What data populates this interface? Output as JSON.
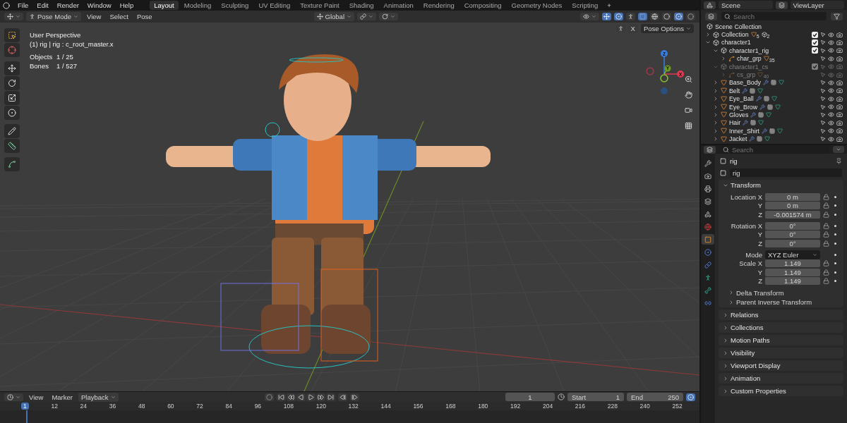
{
  "topbar": {
    "menus": [
      "File",
      "Edit",
      "Render",
      "Window",
      "Help"
    ],
    "workspaces": [
      {
        "label": "Layout",
        "selected": true
      },
      {
        "label": "Modeling",
        "selected": false
      },
      {
        "label": "Sculpting",
        "selected": false
      },
      {
        "label": "UV Editing",
        "selected": false
      },
      {
        "label": "Texture Paint",
        "selected": false
      },
      {
        "label": "Shading",
        "selected": false
      },
      {
        "label": "Animation",
        "selected": false
      },
      {
        "label": "Rendering",
        "selected": false
      },
      {
        "label": "Compositing",
        "selected": false
      },
      {
        "label": "Geometry Nodes",
        "selected": false
      },
      {
        "label": "Scripting",
        "selected": false
      }
    ],
    "add_tab": "+"
  },
  "viewport": {
    "header": {
      "mode": "Pose Mode",
      "menus": [
        "View",
        "Select",
        "Pose"
      ],
      "orientation": "Global"
    },
    "info": {
      "view": "User Perspective",
      "object": "(1) rig | rig : c_root_master.x",
      "stats": [
        {
          "label": "Objects",
          "value": "1 / 25"
        },
        {
          "label": "Bones",
          "value": "1 / 527"
        }
      ]
    },
    "x_mirror": "X",
    "pose_options": "Pose Options",
    "gizmo_axes": [
      "Z",
      "Y",
      "X"
    ]
  },
  "outliner": {
    "scene": "Scene",
    "view_layer": "ViewLayer",
    "search": {
      "placeholder": "Search"
    },
    "root": "Scene Collection",
    "items": [
      {
        "name": "Collection",
        "kind": "collection",
        "expanded": false,
        "disabled": false,
        "checked": true,
        "badges": [
          "5",
          "2"
        ]
      },
      {
        "name": "character1",
        "kind": "collection",
        "expanded": true,
        "disabled": false,
        "checked": true,
        "children": [
          {
            "name": "character1_rig",
            "kind": "collection",
            "expanded": true,
            "disabled": false,
            "checked": true,
            "children": [
              {
                "name": "char_grp",
                "kind": "armature",
                "expanded": false,
                "disabled": false,
                "badges": [
                  "35"
                ]
              }
            ]
          },
          {
            "name": "character1_cs",
            "kind": "collection",
            "expanded": true,
            "disabled": true,
            "checked": true,
            "children": [
              {
                "name": "cs_grp",
                "kind": "armature",
                "expanded": false,
                "disabled": true,
                "badges": [
                  "40"
                ]
              }
            ]
          },
          {
            "name": "Base_Body",
            "kind": "mesh",
            "expanded": false,
            "disabled": false
          },
          {
            "name": "Belt",
            "kind": "mesh",
            "expanded": false,
            "disabled": false
          },
          {
            "name": "Eye_Ball",
            "kind": "mesh",
            "expanded": false,
            "disabled": false
          },
          {
            "name": "Eye_Brow",
            "kind": "mesh",
            "expanded": false,
            "disabled": false
          },
          {
            "name": "Gloves",
            "kind": "mesh",
            "expanded": false,
            "disabled": false
          },
          {
            "name": "Hair",
            "kind": "mesh",
            "expanded": false,
            "disabled": false
          },
          {
            "name": "Inner_Shirt",
            "kind": "mesh",
            "expanded": false,
            "disabled": false
          },
          {
            "name": "Jacket",
            "kind": "mesh",
            "expanded": false,
            "disabled": false
          }
        ]
      }
    ]
  },
  "properties": {
    "search": {
      "placeholder": "Search"
    },
    "tabs": [
      {
        "kind": "tool",
        "selected": false
      },
      {
        "kind": "render",
        "selected": false
      },
      {
        "kind": "output",
        "selected": false
      },
      {
        "kind": "view_layer",
        "selected": false
      },
      {
        "kind": "scene",
        "selected": false
      },
      {
        "kind": "world",
        "selected": false
      },
      {
        "kind": "object",
        "selected": true
      },
      {
        "kind": "physics",
        "selected": false
      },
      {
        "kind": "constraints",
        "selected": false
      },
      {
        "kind": "armature",
        "selected": false
      },
      {
        "kind": "bone",
        "selected": false
      },
      {
        "kind": "bone_constraint",
        "selected": false
      }
    ],
    "object": "rig",
    "data_name": "rig",
    "transform": {
      "title": "Transform",
      "expanded": true,
      "groups": [
        {
          "rows": [
            {
              "label": "Location X",
              "value": "0 m"
            },
            {
              "label": "Y",
              "value": "0 m"
            },
            {
              "label": "Z",
              "value": "-0.001574 m"
            }
          ]
        },
        {
          "rows": [
            {
              "label": "Rotation X",
              "value": "0°"
            },
            {
              "label": "Y",
              "value": "0°"
            },
            {
              "label": "Z",
              "value": "0°"
            }
          ]
        }
      ],
      "mode_label": "Mode",
      "mode": "XYZ Euler",
      "scale": [
        {
          "label": "Scale X",
          "value": "1.149"
        },
        {
          "label": "Y",
          "value": "1.149"
        },
        {
          "label": "Z",
          "value": "1.149"
        }
      ],
      "subpanels": [
        "Delta Transform",
        "Parent Inverse Transform"
      ]
    },
    "panels": [
      "Relations",
      "Collections",
      "Motion Paths",
      "Visibility",
      "Viewport Display",
      "Animation",
      "Custom Properties"
    ]
  },
  "timeline": {
    "menus": [
      {
        "label": "View",
        "kind": "menu"
      },
      {
        "label": "Marker",
        "kind": "menu"
      },
      {
        "label": "Playback",
        "kind": "dropdown"
      }
    ],
    "current_frame": "1",
    "start_label": "Start",
    "start": "1",
    "end_label": "End",
    "end": "250",
    "marker": "1",
    "ticks": [
      "12",
      "24",
      "36",
      "48",
      "60",
      "72",
      "84",
      "96",
      "108",
      "120",
      "132",
      "144",
      "156",
      "168",
      "180",
      "192",
      "204",
      "216",
      "228",
      "240",
      "252"
    ]
  }
}
